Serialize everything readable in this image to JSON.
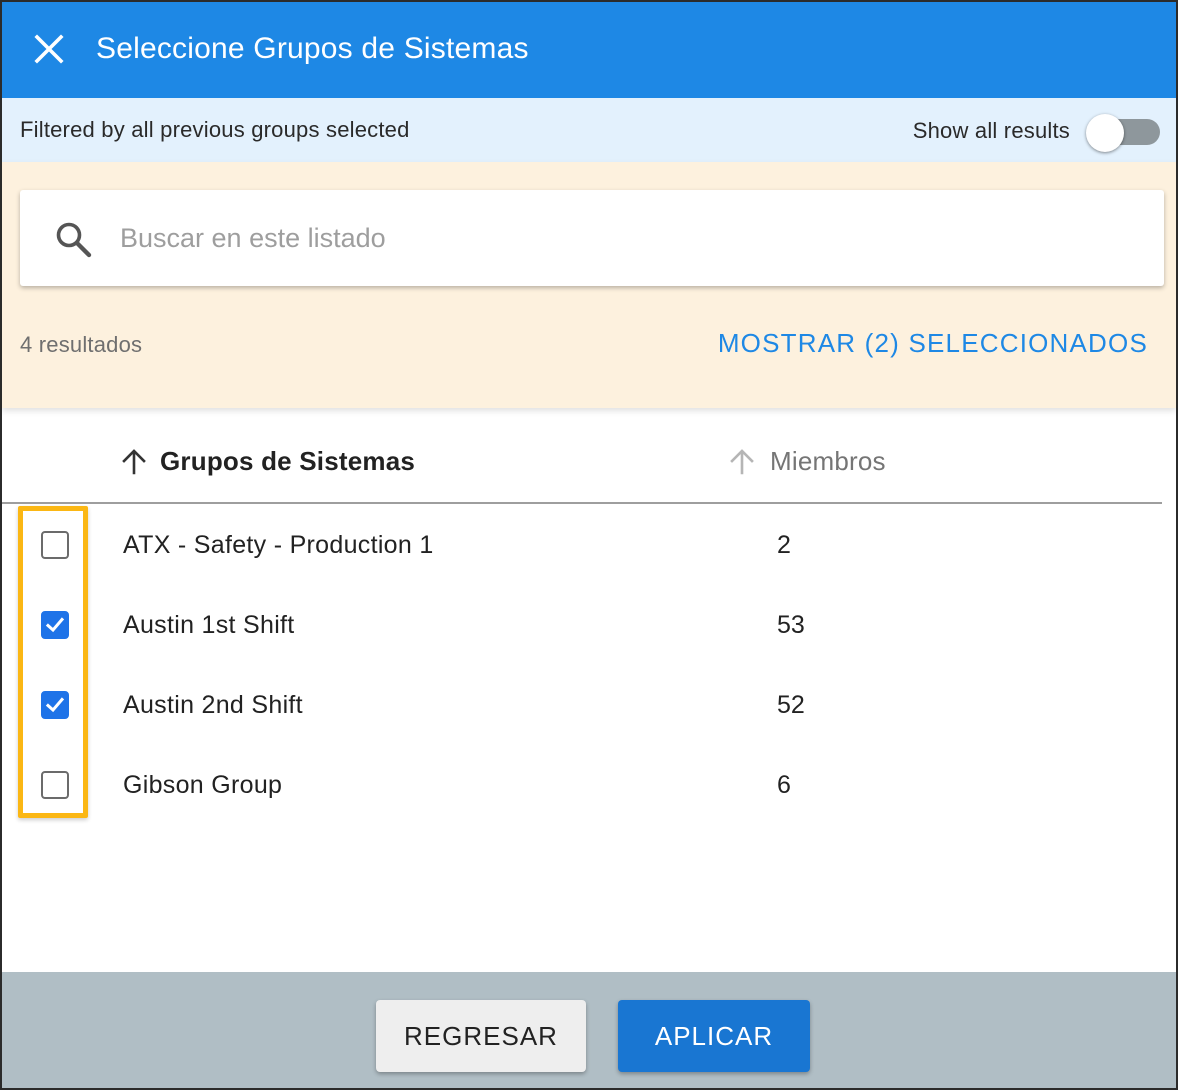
{
  "header": {
    "title": "Seleccione Grupos de Sistemas",
    "close_icon": "close-icon"
  },
  "filter_bar": {
    "text": "Filtered by all previous groups selected",
    "show_all_label": "Show all results",
    "show_all_enabled": false
  },
  "search": {
    "placeholder": "Buscar en este listado",
    "value": "",
    "icon": "search-icon"
  },
  "results": {
    "count_text": "4 resultados",
    "show_selected_label": "MOSTRAR (2) SELECCIONADOS"
  },
  "table": {
    "columns": [
      {
        "label": "Grupos de Sistemas",
        "sort_icon": "arrow-up-icon",
        "active": true
      },
      {
        "label": "Miembros",
        "sort_icon": "arrow-up-icon",
        "active": false
      }
    ],
    "rows": [
      {
        "name": "ATX - Safety - Production 1",
        "members": "2",
        "checked": false
      },
      {
        "name": "Austin 1st Shift",
        "members": "53",
        "checked": true
      },
      {
        "name": "Austin 2nd Shift",
        "members": "52",
        "checked": true
      },
      {
        "name": "Gibson Group",
        "members": "6",
        "checked": false
      }
    ]
  },
  "footer": {
    "back_label": "REGRESAR",
    "apply_label": "APLICAR"
  },
  "colors": {
    "header": "#1e88e5",
    "filter_bar": "#e3f1fd",
    "search_area": "#fdf1de",
    "footer": "#b0bec5",
    "primary_button": "#1976d2",
    "highlight": "#fbb714"
  }
}
